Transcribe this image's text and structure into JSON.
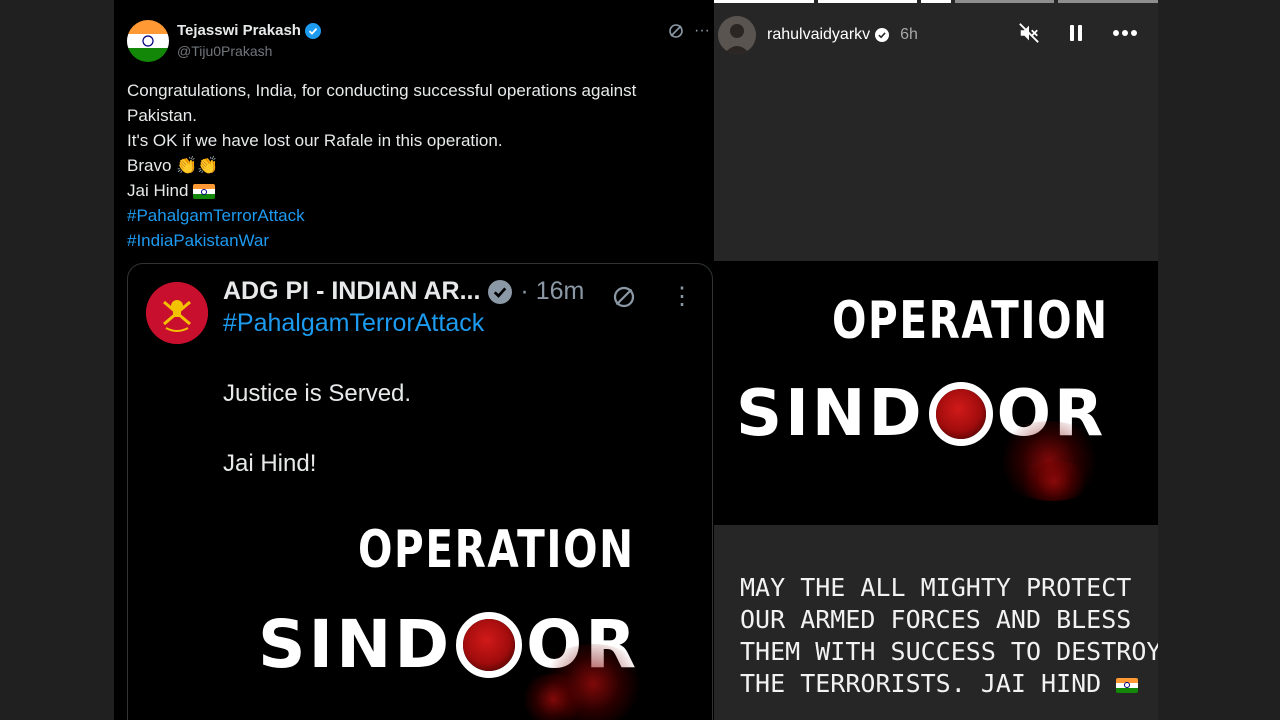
{
  "tweet": {
    "author": "Tejasswi Prakash",
    "handle": "@Tiju0Prakash",
    "lines": [
      "Congratulations, India, for conducting successful operations against",
      "Pakistan.",
      "It's OK if we have lost our Rafale in this operation.",
      "Bravo",
      "Jai Hind"
    ],
    "hashtags": [
      "#PahalgamTerrorAttack",
      "#IndiaPakistanWar"
    ],
    "icons": [
      "verified-badge-icon",
      "grok-icon",
      "more-icon",
      "clapping-hands-icon",
      "india-flag-icon"
    ],
    "colors": {
      "hashtag": "#1d9bf0",
      "verified": "#1d9bf0"
    }
  },
  "quote": {
    "author": "ADG PI - INDIAN AR...",
    "time": "· 16m",
    "hashtag": "#PahalgamTerrorAttack",
    "line1": "Justice is Served.",
    "line2": "Jai Hind!",
    "poster_top": "OPERATION",
    "poster_left": "SIND",
    "poster_right": "OR"
  },
  "story": {
    "username": "rahulvaidyarkv",
    "time": "6h",
    "poster_top": "OPERATION",
    "poster_left": "SIND",
    "poster_right": "OR",
    "caption_lines": [
      "MAY THE ALL MIGHTY PROTECT",
      "OUR ARMED FORCES AND BLESS",
      "THEM WITH SUCCESS TO DESTROY",
      "THE TERRORISTS. JAI HIND"
    ],
    "icons": [
      "mute-icon",
      "pause-icon",
      "more-icon"
    ]
  }
}
